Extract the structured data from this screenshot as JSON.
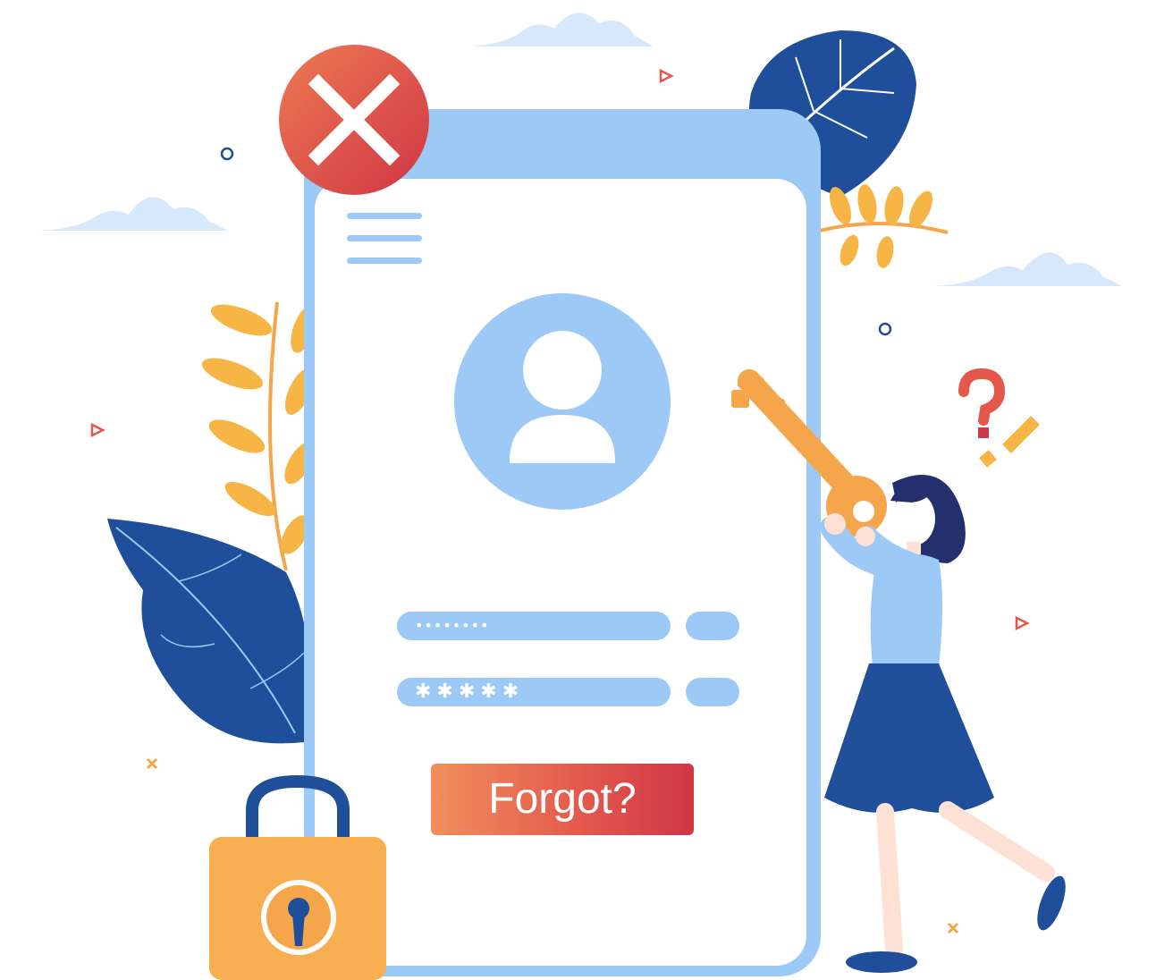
{
  "screen": {
    "username_value": "••••••••",
    "password_value": "✱✱✱✱✱",
    "forgot_label": "Forgot?"
  },
  "icons": {
    "error": "close-icon",
    "menu": "menu-icon",
    "profile": "user-icon",
    "lock": "padlock-icon",
    "key": "key-icon",
    "question": "question-mark-icon",
    "exclamation": "exclamation-mark-icon"
  },
  "colors": {
    "phone": "#9cc9f6",
    "button_start": "#f08f5c",
    "button_end": "#cf3646",
    "leaf_dark": "#1f4f9a",
    "leaf_yellow": "#f6b544",
    "lock": "#f6a64a"
  }
}
